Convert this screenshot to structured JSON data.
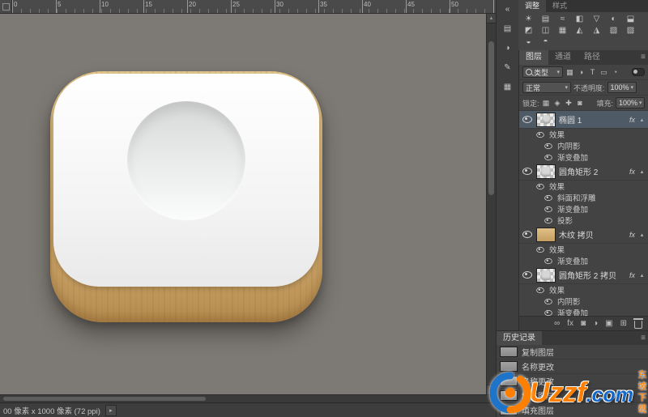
{
  "icons": {
    "caret_down": "▾",
    "caret_up": "▴",
    "tri_right": "▸",
    "menu": "≡",
    "collapse": "«"
  },
  "ruler": {
    "numbers": [
      "0",
      "5",
      "10",
      "15",
      "20",
      "25",
      "30",
      "35",
      "40",
      "45",
      "50"
    ]
  },
  "dock_strip": {
    "icons": [
      "«",
      "▤",
      "◑",
      "✎",
      "▦"
    ]
  },
  "adjustments_panel": {
    "tabs": [
      "调整",
      "样式"
    ],
    "icons": [
      "☀",
      "▤",
      "≈",
      "◧",
      "▽",
      "◐",
      "⬓",
      "◩",
      "◫",
      "▦",
      "◭",
      "◮",
      "▧",
      "▨",
      "◒",
      "◓"
    ]
  },
  "layers_panel": {
    "tabs": [
      "图层",
      "通道",
      "路径"
    ],
    "filter": {
      "kind_label": "类型",
      "icons": [
        "▦",
        "◑",
        "T",
        "▭",
        "◔"
      ]
    },
    "blend": {
      "mode": "正常",
      "opacity_label": "不透明度:",
      "opacity": "100%"
    },
    "lock": {
      "label": "锁定:",
      "icons": [
        "▦",
        "◈",
        "✚",
        "◙"
      ],
      "fill_label": "填充:",
      "fill": "100%"
    },
    "fx_label": "fx",
    "rows": [
      {
        "label": "椭圆 1",
        "kind": "layer"
      },
      {
        "label": "效果",
        "kind": "effects"
      },
      {
        "label": "内阴影",
        "kind": "effect"
      },
      {
        "label": "渐变叠加",
        "kind": "effect"
      },
      {
        "label": "圆角矩形 2",
        "kind": "layer"
      },
      {
        "label": "效果",
        "kind": "effects"
      },
      {
        "label": "斜面和浮雕",
        "kind": "effect"
      },
      {
        "label": "渐变叠加",
        "kind": "effect"
      },
      {
        "label": "投影",
        "kind": "effect"
      },
      {
        "label": "木纹 拷贝",
        "kind": "layer"
      },
      {
        "label": "效果",
        "kind": "effects"
      },
      {
        "label": "渐变叠加",
        "kind": "effect"
      },
      {
        "label": "圆角矩形 2 拷贝",
        "kind": "layer"
      },
      {
        "label": "效果",
        "kind": "effects"
      },
      {
        "label": "内阴影",
        "kind": "effect"
      },
      {
        "label": "渐变叠加",
        "kind": "effect"
      }
    ],
    "bottom_icons": [
      "∞",
      "fx",
      "◙",
      "◑",
      "▣",
      "⊞"
    ]
  },
  "history_panel": {
    "title": "历史记录",
    "items": [
      "复制图层",
      "名称更改",
      "名称更改",
      "填充图层",
      "填充图层"
    ]
  },
  "status_bar": {
    "text": "00 像素 x 1000 像素 (72 ppi)"
  },
  "watermark": {
    "brand": "Uzzf",
    "tld": ".com",
    "tagline": "东坡下载"
  },
  "colors": {
    "canvas_bg": "#7d7974",
    "wood": "#d5b176",
    "panel_bg": "#434343",
    "selected_row": "#4e5a66",
    "accent_orange": "#ff7f00",
    "accent_blue": "#1467c8"
  }
}
